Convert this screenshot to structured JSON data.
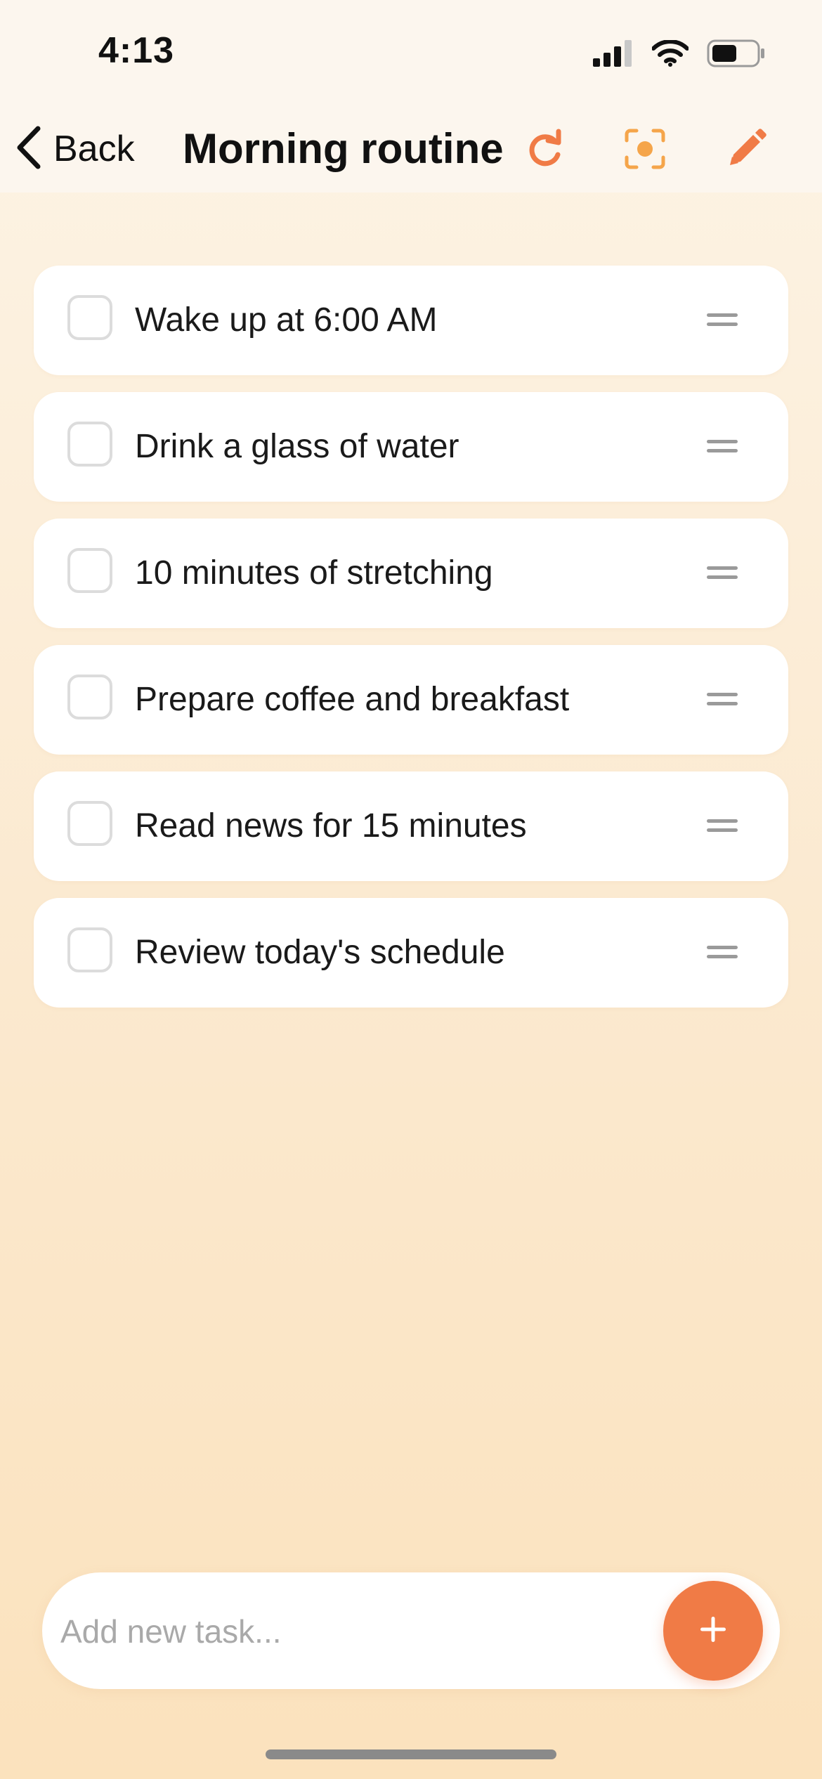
{
  "status_bar": {
    "time": "4:13",
    "icons": [
      "cellular-signal-icon",
      "wifi-icon",
      "battery-icon"
    ]
  },
  "nav": {
    "back_label": "Back",
    "title": "Morning routine",
    "actions": [
      "refresh-icon",
      "focus-icon",
      "pencil-icon"
    ]
  },
  "tasks": [
    {
      "label": "Wake up at 6:00 AM",
      "checked": false
    },
    {
      "label": "Drink a glass of water",
      "checked": false
    },
    {
      "label": "10 minutes of stretching",
      "checked": false
    },
    {
      "label": "Prepare coffee and breakfast",
      "checked": false
    },
    {
      "label": "Read news for 15 minutes",
      "checked": false
    },
    {
      "label": "Review today's schedule",
      "checked": false
    }
  ],
  "add_task": {
    "placeholder": "Add new task...",
    "value": ""
  },
  "colors": {
    "accent": "#f07b46",
    "focus_accent": "#f5a54a",
    "background_top": "#fdf4e6",
    "background_bottom": "#fbe2bd",
    "card": "#ffffff",
    "checkbox_border": "#dcdcdc",
    "drag_handle": "#9a9a9a"
  }
}
